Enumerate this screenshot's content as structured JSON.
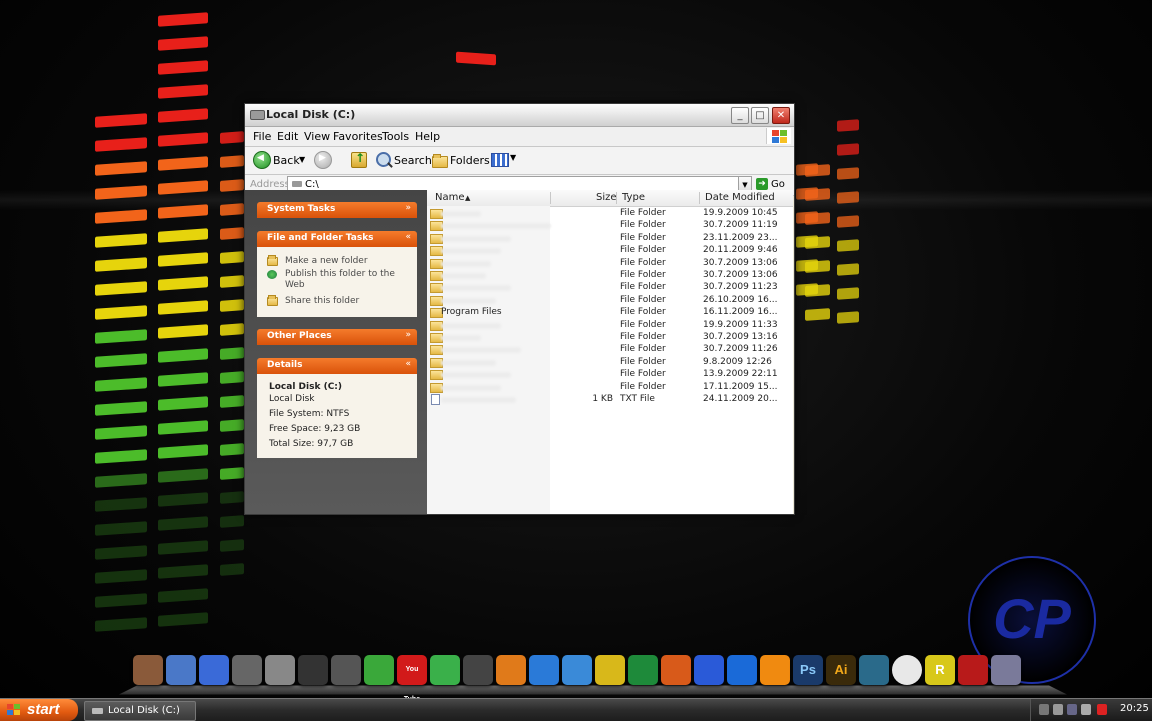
{
  "window": {
    "title": "Local Disk (C:)",
    "menu": [
      "File",
      "Edit",
      "View",
      "Favorites",
      "Tools",
      "Help"
    ],
    "toolbar": {
      "back_label": "Back",
      "search_label": "Search",
      "folders_label": "Folders"
    },
    "address": {
      "label": "Address",
      "value": "C:\\",
      "go_label": "Go"
    }
  },
  "tasks": {
    "system_tasks": "System Tasks",
    "file_folder_tasks": "File and Folder Tasks",
    "items": [
      "Make a new folder",
      "Publish this folder to the Web",
      "Share this folder"
    ],
    "other_places": "Other Places",
    "details": {
      "header": "Details",
      "name": "Local Disk (C:)",
      "kind": "Local Disk",
      "filesystem": "File System: NTFS",
      "free": "Free Space: 9,23 GB",
      "total": "Total Size: 97,7 GB"
    }
  },
  "list": {
    "columns": {
      "name": "Name",
      "size": "Size",
      "type": "Type",
      "date": "Date Modified"
    },
    "rows": [
      {
        "name": "",
        "size": "",
        "type": "File Folder",
        "date": "19.9.2009 10:45"
      },
      {
        "name": "",
        "size": "",
        "type": "File Folder",
        "date": "30.7.2009 11:19"
      },
      {
        "name": "",
        "size": "",
        "type": "File Folder",
        "date": "23.11.2009 23..."
      },
      {
        "name": "",
        "size": "",
        "type": "File Folder",
        "date": "20.11.2009 9:46"
      },
      {
        "name": "",
        "size": "",
        "type": "File Folder",
        "date": "30.7.2009 13:06"
      },
      {
        "name": "",
        "size": "",
        "type": "File Folder",
        "date": "30.7.2009 13:06"
      },
      {
        "name": "",
        "size": "",
        "type": "File Folder",
        "date": "30.7.2009 11:23"
      },
      {
        "name": "",
        "size": "",
        "type": "File Folder",
        "date": "26.10.2009 16..."
      },
      {
        "name": "Program Files",
        "size": "",
        "type": "File Folder",
        "date": "16.11.2009 16..."
      },
      {
        "name": "",
        "size": "",
        "type": "File Folder",
        "date": "19.9.2009 11:33"
      },
      {
        "name": "",
        "size": "",
        "type": "File Folder",
        "date": "30.7.2009 13:16"
      },
      {
        "name": "",
        "size": "",
        "type": "File Folder",
        "date": "30.7.2009 11:26"
      },
      {
        "name": "",
        "size": "",
        "type": "File Folder",
        "date": "9.8.2009 12:26"
      },
      {
        "name": "",
        "size": "",
        "type": "File Folder",
        "date": "13.9.2009 22:11"
      },
      {
        "name": "",
        "size": "",
        "type": "File Folder",
        "date": "17.11.2009 15..."
      },
      {
        "name": "",
        "size": "1 KB",
        "type": "TXT File",
        "date": "24.11.2009 20..."
      }
    ]
  },
  "dock": {
    "icons": [
      "trash",
      "network",
      "notes",
      "media",
      "music",
      "dvd",
      "tools",
      "utorrent",
      "youtube",
      "messenger",
      "wifi",
      "firefox",
      "ie",
      "safari",
      "chrome",
      "excel",
      "powerpoint",
      "word",
      "media-player",
      "vlc",
      "photoshop",
      "illustrator",
      "pen",
      "clock",
      "rainlendar",
      "game",
      "window"
    ],
    "labels": {
      "youtube": "You Tube",
      "photoshop": "Ps",
      "illustrator": "Ai",
      "rainlendar": "R"
    }
  },
  "logo_text": "CP",
  "taskbar": {
    "start_label": "start",
    "task_label": "Local Disk (C:)",
    "clock": "20:25"
  }
}
